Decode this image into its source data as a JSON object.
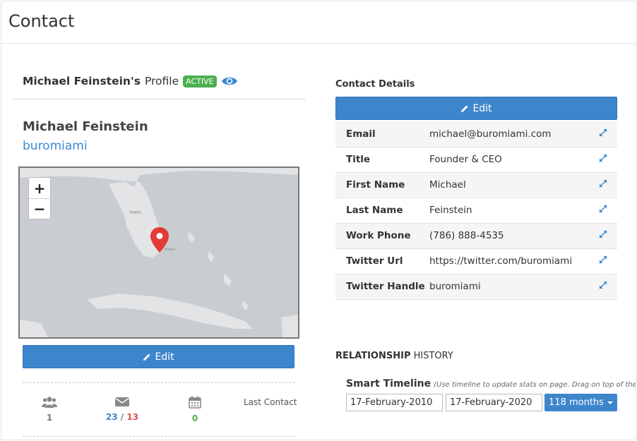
{
  "page": {
    "title": "Contact"
  },
  "profile": {
    "owner_name": "Michael Feinstein's",
    "suffix": "Profile",
    "status": "ACTIVE",
    "full_name": "Michael Feinstein",
    "company": "buromiami",
    "edit_label": "Edit"
  },
  "map": {
    "zoom_in": "+",
    "zoom_out": "−",
    "marker_color": "#e53935"
  },
  "stats": {
    "people": "1",
    "email_sent": "23",
    "separator": "/",
    "email_received": "13",
    "events": "0",
    "last_contact_label": "Last Contact"
  },
  "contact_details": {
    "title": "Contact Details",
    "edit_label": "Edit",
    "rows": [
      {
        "label": "Email",
        "value": "michael@buromiami.com"
      },
      {
        "label": "Title",
        "value": "Founder & CEO"
      },
      {
        "label": "First Name",
        "value": "Michael"
      },
      {
        "label": "Last Name",
        "value": "Feinstein"
      },
      {
        "label": "Work Phone",
        "value": "(786) 888-4535"
      },
      {
        "label": "Twitter Url",
        "value": "https://twitter.com/buromiami"
      },
      {
        "label": "Twitter Handle",
        "value": "buromiami"
      }
    ]
  },
  "relationship": {
    "heading_bold": "RELATIONSHIP",
    "heading_rest": "HISTORY",
    "timeline_label": "Smart Timeline",
    "timeline_hint": "(Use timeline to update stats on page. Drag on top of the timeline",
    "start_date": "17-February-2010",
    "end_date": "17-February-2020",
    "range_label": "118 months"
  },
  "colors": {
    "accent": "#3e86cc",
    "active_badge": "#4caf50",
    "link": "#3a8ad0",
    "sent": "#3a8ad0",
    "received": "#d9534f",
    "events": "#4caf50"
  }
}
